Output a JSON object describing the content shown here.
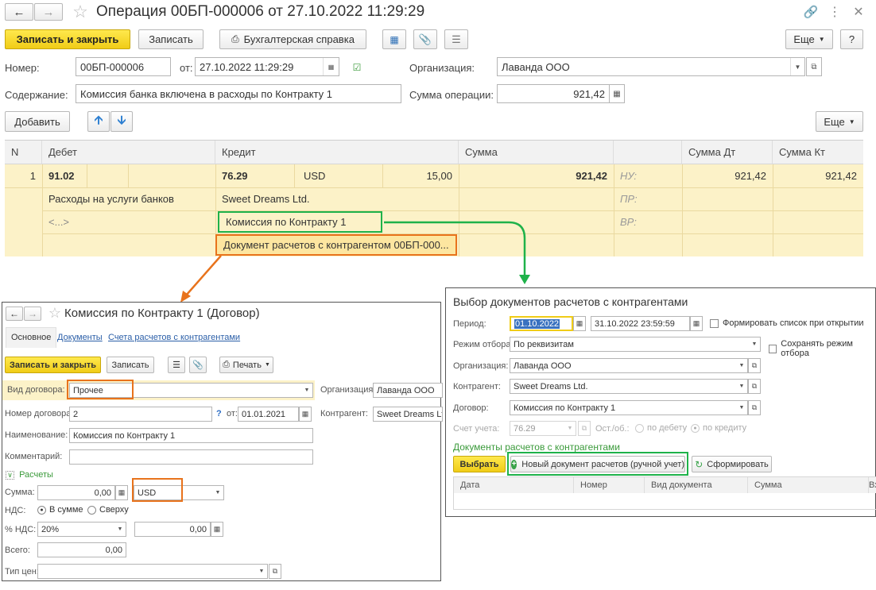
{
  "main": {
    "title": "Операция 00БП-000006 от 27.10.2022 11:29:29",
    "toolbar": {
      "save_close": "Записать и закрыть",
      "save": "Записать",
      "report": "Бухгалтерская справка",
      "more": "Еще",
      "help": "?"
    },
    "fields": {
      "number_label": "Номер:",
      "number_value": "00БП-000006",
      "date_label": "от:",
      "date_value": "27.10.2022 11:29:29",
      "org_label": "Организация:",
      "org_value": "Лаванда ООО",
      "content_label": "Содержание:",
      "content_value": "Комиссия банка включена в расходы по Контракту 1",
      "sum_label": "Сумма операции:",
      "sum_value": "921,42"
    },
    "table_toolbar": {
      "add": "Добавить",
      "more": "Еще"
    },
    "columns": [
      "N",
      "Дебет",
      "Кредит",
      "Сумма",
      "",
      "Сумма Дт",
      "Сумма Кт"
    ],
    "row": {
      "n": "1",
      "debit_account": "91.02",
      "credit_account": "76.29",
      "currency": "USD",
      "currency_amount": "15,00",
      "amount": "921,42",
      "nu": "НУ:",
      "pr": "ПР:",
      "vr": "ВР:",
      "sum_dt": "921,42",
      "sum_kt": "921,42",
      "debit_sub1": "Расходы на услуги банков",
      "debit_sub2": "<...>",
      "credit_sub1": "Sweet Dreams Ltd.",
      "credit_sub2": "Комиссия по Контракту 1",
      "credit_sub3": "Документ расчетов с контрагентом 00БП-000..."
    }
  },
  "contract": {
    "title": "Комиссия по Контракту 1 (Договор)",
    "tabs": [
      "Основное",
      "Документы",
      "Счета расчетов с контрагентами"
    ],
    "toolbar": {
      "save_close": "Записать и закрыть",
      "save": "Записать",
      "print": "Печать"
    },
    "kind_label": "Вид договора:",
    "kind_value": "Прочее",
    "org_label": "Организация:",
    "org_value": "Лаванда ООО",
    "num_label": "Номер договора:",
    "num_value": "2",
    "q_mark": "?",
    "date_label": "от:",
    "date_value": "01.01.2021",
    "contractor_label": "Контрагент:",
    "contractor_value": "Sweet Dreams Ltd.",
    "name_label": "Наименование:",
    "name_value": "Комиссия по Контракту 1",
    "comment_label": "Комментарий:",
    "settlements_group": "Расчеты",
    "sum_label": "Сумма:",
    "sum_value": "0,00",
    "currency_value": "USD",
    "vat_label": "НДС:",
    "vat_opt1": "В сумме",
    "vat_opt2": "Сверху",
    "vat_pct_label": "% НДС:",
    "vat_pct_value": "20%",
    "vat_sum_value": "0,00",
    "total_label": "Всего:",
    "total_value": "0,00",
    "price_type_label": "Тип цен:"
  },
  "select": {
    "title": "Выбор документов расчетов с контрагентами",
    "period_label": "Период:",
    "period_from": "01.10.2022",
    "period_to": "31.10.2022 23:59:59",
    "form_on_open": "Формировать список при открытии",
    "mode_label": "Режим отбора:",
    "mode_value": "По реквизитам",
    "save_mode": "Сохранять режим отбора",
    "org_label": "Организация:",
    "org_value": "Лаванда ООО",
    "contractor_label": "Контрагент:",
    "contractor_value": "Sweet Dreams Ltd.",
    "contract_label": "Договор:",
    "contract_value": "Комиссия по Контракту 1",
    "account_label": "Счет учета:",
    "account_value": "76.29",
    "balance_label": "Ост./об.:",
    "by_debit": "по дебету",
    "by_credit": "по кредиту",
    "docs_group": "Документы расчетов с контрагентами",
    "choose": "Выбрать",
    "new_doc": "Новый документ расчетов (ручной учет)",
    "generate": "Сформировать",
    "columns": [
      "Дата",
      "Номер",
      "Вид документа",
      "Сумма",
      "Вх. н"
    ]
  }
}
